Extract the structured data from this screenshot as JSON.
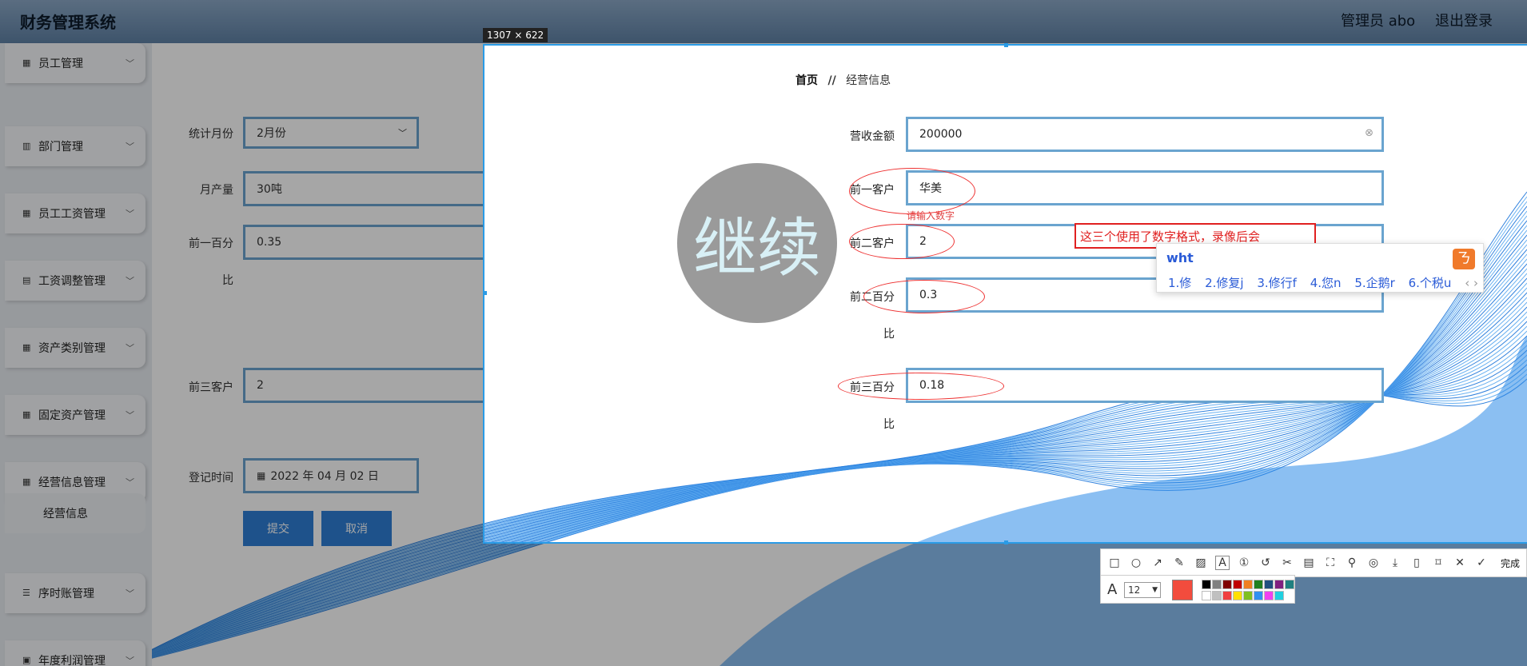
{
  "app": {
    "title": "财务管理系统",
    "user": "管理员 abo",
    "logout": "退出登录"
  },
  "sidebar": {
    "items": [
      {
        "label": "员工管理",
        "icon": "grid-icon"
      },
      {
        "label": "部门管理",
        "icon": "bar-chart-icon"
      },
      {
        "label": "员工工资管理",
        "icon": "grid-icon"
      },
      {
        "label": "工资调整管理",
        "icon": "clipboard-icon"
      },
      {
        "label": "资产类别管理",
        "icon": "grid-icon"
      },
      {
        "label": "固定资产管理",
        "icon": "grid-icon"
      },
      {
        "label": "经营信息管理",
        "icon": "grid-icon"
      },
      {
        "label": "序时账管理",
        "icon": "list-icon"
      },
      {
        "label": "年度利润管理",
        "icon": "check-clipboard-icon"
      }
    ],
    "active_sub": "经营信息"
  },
  "form_left": {
    "month_label": "统计月份",
    "month_value": "2月份",
    "output_label": "月产量",
    "output_value": "30吨",
    "top1_pct_label_a": "前一百分",
    "top1_pct_label_b": "比",
    "top1_pct_value": "0.35",
    "top3_label": "前三客户",
    "top3_value": "2",
    "date_label": "登记时间",
    "date_value": "2022 年 04 月 02 日",
    "submit": "提交",
    "cancel": "取消"
  },
  "capture": {
    "size_label": "1307 × 622",
    "breadcrumb": {
      "home": "首页",
      "sep": "//",
      "current": "经营信息"
    },
    "fields": {
      "revenue_label": "营收金额",
      "revenue_value": "200000",
      "top1_label": "前一客户",
      "top1_value": "华美",
      "error": "请输入数字",
      "top2_label": "前二客户",
      "top2_value": "2",
      "top2_pct_label_a": "前二百分",
      "top2_pct_label_b": "比",
      "top2_pct_value": "0.3",
      "top3_pct_label_a": "前三百分",
      "top3_pct_label_b": "比",
      "top3_pct_value": "0.18"
    },
    "continue_text": "继续",
    "annotation": "这三个使用了数字格式，录像后会"
  },
  "ime": {
    "composition": "wht",
    "candidates": [
      "1.修",
      "2.修复j",
      "3.修行f",
      "4.您n",
      "5.企鹅r",
      "6.个税u"
    ]
  },
  "toolbar": {
    "done_label": "完成",
    "font_size": "12",
    "current_color": "#f24c3d",
    "palette": [
      "#000000",
      "#808080",
      "#800000",
      "#c00000",
      "#f08020",
      "#208020",
      "#205080",
      "#802080",
      "#208080",
      "#ffffff",
      "#c0c0c0",
      "#f04040",
      "#ffe000",
      "#80c020",
      "#3090f0",
      "#f040f0",
      "#20d0e0"
    ]
  }
}
